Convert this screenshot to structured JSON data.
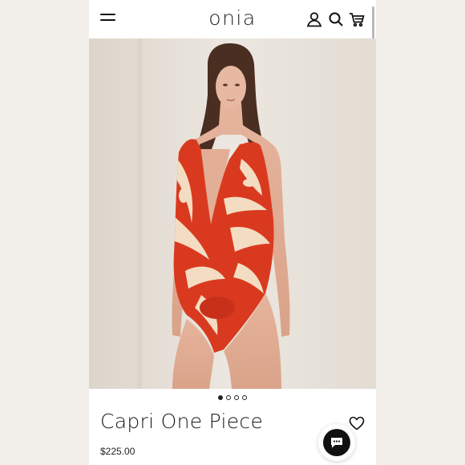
{
  "header": {
    "logo": "onia",
    "menu_icon": "hamburger-menu-icon",
    "icons": [
      "account-icon",
      "search-icon",
      "cart-icon"
    ]
  },
  "gallery": {
    "image": "model-wearing-red-floral-one-piece-swimsuit",
    "slide_count": 4,
    "active_slide": 1
  },
  "product": {
    "title": "Capri One Piece",
    "price": "$225.00",
    "wishlist_icon": "heart-icon"
  },
  "chat_widget": {
    "icon": "chat-bubble-icon"
  },
  "colors": {
    "swim_red": "#d93a1f",
    "swim_cream": "#f3dcc1",
    "text": "#1a1a1a",
    "background": "#ffffff"
  }
}
